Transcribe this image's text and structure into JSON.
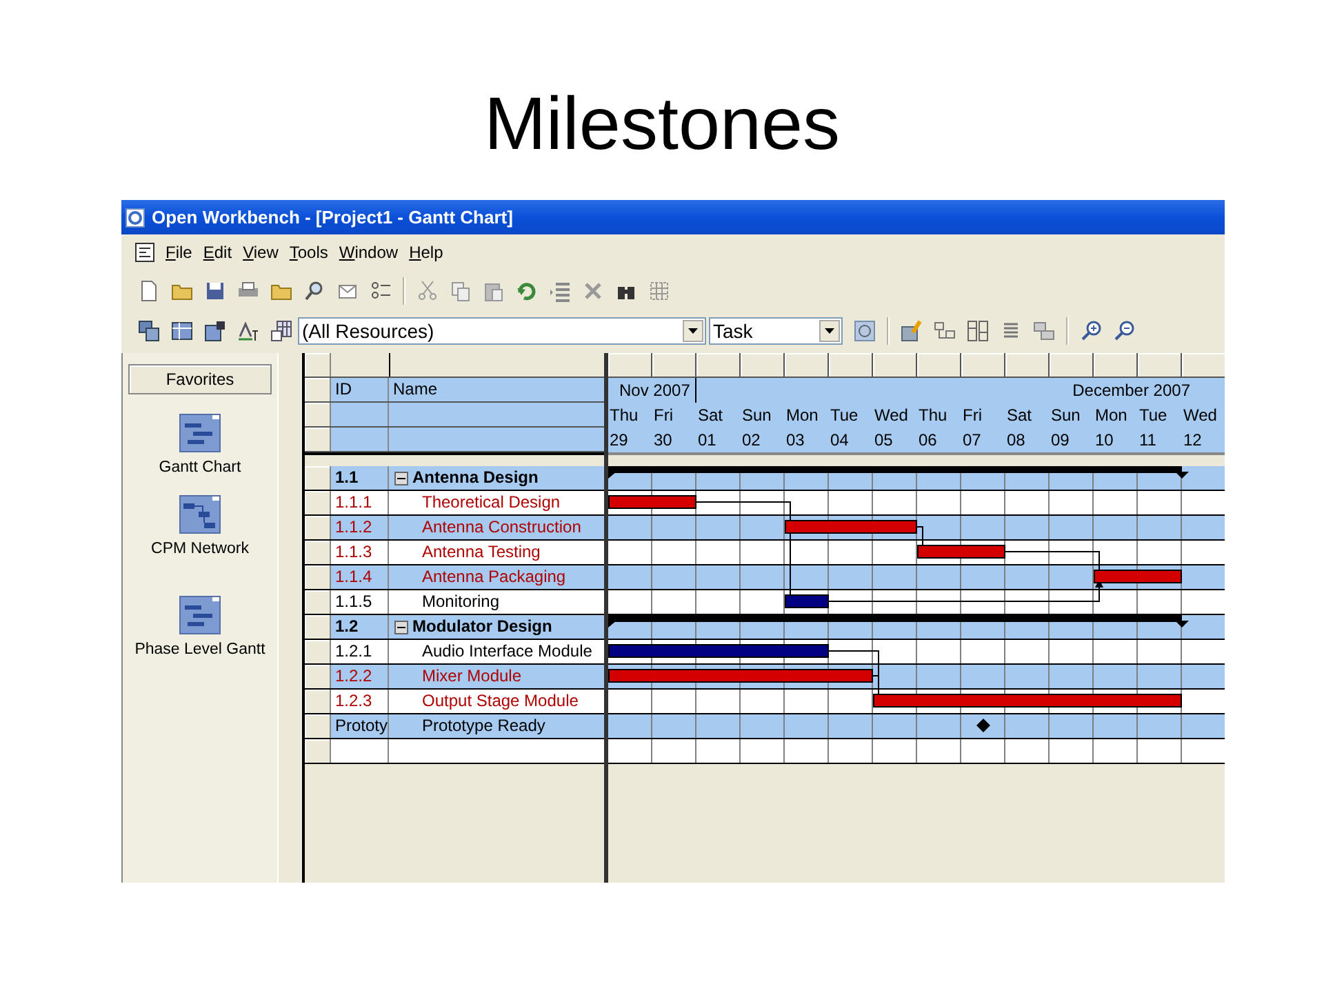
{
  "slide": {
    "title": "Milestones"
  },
  "window": {
    "title": "Open Workbench - [Project1 - Gantt Chart]"
  },
  "menu": [
    "File",
    "Edit",
    "View",
    "Tools",
    "Window",
    "Help"
  ],
  "toolbar": {
    "resource_filter": "(All Resources)",
    "view_filter": "Task"
  },
  "sidebar": {
    "header": "Favorites",
    "items": [
      {
        "label": "Gantt Chart",
        "kind": "gantt"
      },
      {
        "label": "CPM Network",
        "kind": "network"
      },
      {
        "label": "Phase Level Gantt",
        "kind": "gantt"
      }
    ]
  },
  "grid": {
    "columns": [
      "ID",
      "Name"
    ]
  },
  "timeline": {
    "months": [
      {
        "label": "Nov 2007"
      },
      {
        "label": "December 2007"
      }
    ],
    "days": [
      {
        "weekday": "Thu",
        "day": "29"
      },
      {
        "weekday": "Fri",
        "day": "30"
      },
      {
        "weekday": "Sat",
        "day": "01"
      },
      {
        "weekday": "Sun",
        "day": "02"
      },
      {
        "weekday": "Mon",
        "day": "03"
      },
      {
        "weekday": "Tue",
        "day": "04"
      },
      {
        "weekday": "Wed",
        "day": "05"
      },
      {
        "weekday": "Thu",
        "day": "06"
      },
      {
        "weekday": "Fri",
        "day": "07"
      },
      {
        "weekday": "Sat",
        "day": "08"
      },
      {
        "weekday": "Sun",
        "day": "09"
      },
      {
        "weekday": "Mon",
        "day": "10"
      },
      {
        "weekday": "Tue",
        "day": "11"
      },
      {
        "weekday": "Wed",
        "day": "12"
      }
    ]
  },
  "tasks": [
    {
      "wbs": "1.1",
      "name": "Antenna Design",
      "kind": "summary",
      "expanded": true,
      "children": [
        {
          "wbs": "1.1.1",
          "name": "Theoretical Design",
          "kind": "task",
          "critical": true
        },
        {
          "wbs": "1.1.2",
          "name": "Antenna Construction",
          "kind": "task",
          "critical": true
        },
        {
          "wbs": "1.1.3",
          "name": "Antenna Testing",
          "kind": "task",
          "critical": true
        },
        {
          "wbs": "1.1.4",
          "name": "Antenna Packaging",
          "kind": "task",
          "critical": true
        },
        {
          "wbs": "1.1.5",
          "name": "Monitoring",
          "kind": "task",
          "critical": false
        }
      ]
    },
    {
      "wbs": "1.2",
      "name": "Modulator Design",
      "kind": "summary",
      "expanded": true,
      "children": [
        {
          "wbs": "1.2.1",
          "name": "Audio Interface Module",
          "kind": "task",
          "critical": false
        },
        {
          "wbs": "1.2.2",
          "name": "Mixer Module",
          "kind": "task",
          "critical": true
        },
        {
          "wbs": "1.2.3",
          "name": "Output Stage Module",
          "kind": "task",
          "critical": true
        }
      ]
    },
    {
      "wbs": "Prototy",
      "name": "Prototype Ready",
      "kind": "milestone",
      "critical": false
    }
  ]
}
